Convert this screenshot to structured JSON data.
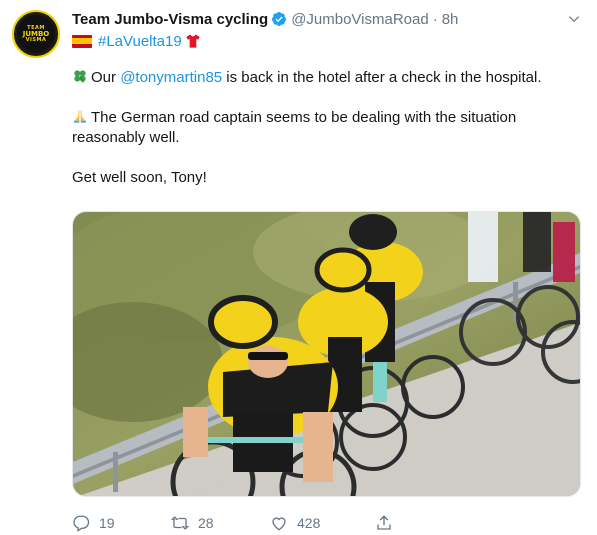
{
  "author": {
    "name": "Team Jumbo-Visma cycling",
    "handle": "@JumboVismaRoad",
    "separator": "·",
    "time": "8h",
    "avatar_text": [
      "TEAM",
      "JUMBO",
      "VISMA"
    ]
  },
  "bio": {
    "hashtag": "#LaVuelta19"
  },
  "tweet": {
    "p1_mention": "@tonymartin85",
    "p1_pre": "Our ",
    "p1_post": " is back in the hotel after a check in the hospital.",
    "p2": "The German road captain seems to be dealing with the situation reasonably well.",
    "p3": "Get well soon, Tony!"
  },
  "actions": {
    "replies": "19",
    "retweets": "28",
    "likes": "428"
  },
  "colors": {
    "link": "#1b95e0",
    "muted": "#657786",
    "text": "#14171a",
    "verified": "#1da1f2",
    "team_yellow": "#f5d800"
  },
  "icons": {
    "verified": "verified-badge-icon",
    "caret": "chevron-down-icon",
    "clover": "four-leaf-clover-icon",
    "pray": "folded-hands-icon",
    "jersey": "red-jersey-icon",
    "reply": "reply-icon",
    "retweet": "retweet-icon",
    "like": "heart-icon",
    "share": "share-icon"
  }
}
